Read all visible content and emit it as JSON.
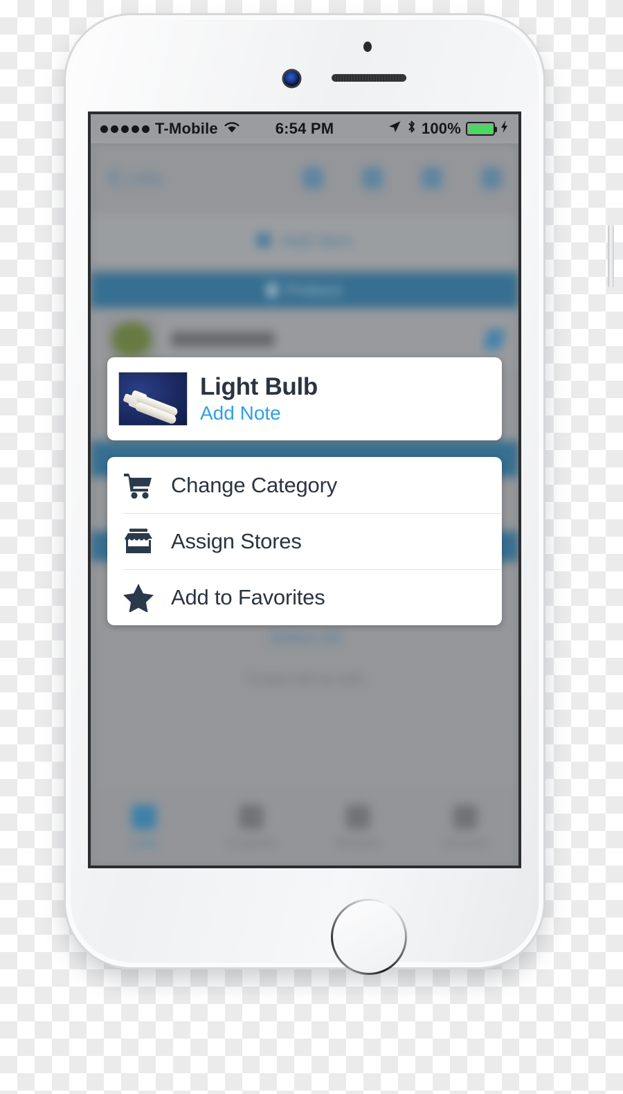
{
  "status_bar": {
    "signal_dots": 5,
    "carrier": "T-Mobile",
    "wifi_icon": "wifi-icon",
    "time": "6:54 PM",
    "location_icon": "location-arrow-icon",
    "bluetooth_icon": "bluetooth-icon",
    "battery_percent": "100%",
    "battery_level": 100,
    "battery_color": "#4ad860",
    "charging_icon": "lightning-bolt-icon"
  },
  "background": {
    "back_label": "Lists",
    "nav_icons": [
      "person-icon",
      "share-icon",
      "filter-icon",
      "menu-icon"
    ],
    "add_item_label": "Add Item",
    "section_header_label": "Produce",
    "list_row_title": "Broccoli",
    "edit_icon": "pencil-icon",
    "blue_text": "Select All",
    "grey_text": "Swipe left to edit",
    "tabs": [
      {
        "label": "Lists",
        "icon": "list-icon",
        "active": true
      },
      {
        "label": "Coupons",
        "icon": "coupon-icon",
        "active": false
      },
      {
        "label": "Recipes",
        "icon": "recipe-icon",
        "active": false
      },
      {
        "label": "Account",
        "icon": "person-icon",
        "active": false
      }
    ]
  },
  "item_card": {
    "thumbnail_icon": "light-bulb-thumbnail",
    "title": "Light Bulb",
    "add_note_label": "Add Note",
    "accent_color": "#2e9fe8"
  },
  "action_menu": {
    "items": [
      {
        "icon": "shopping-cart-icon",
        "label": "Change Category"
      },
      {
        "icon": "storefront-icon",
        "label": "Assign Stores"
      },
      {
        "icon": "star-icon",
        "label": "Add to Favorites"
      }
    ]
  },
  "theme": {
    "section_header_blue": "#15699b",
    "text_dark": "#2b3440",
    "icon_dark": "#2b3a4a"
  }
}
